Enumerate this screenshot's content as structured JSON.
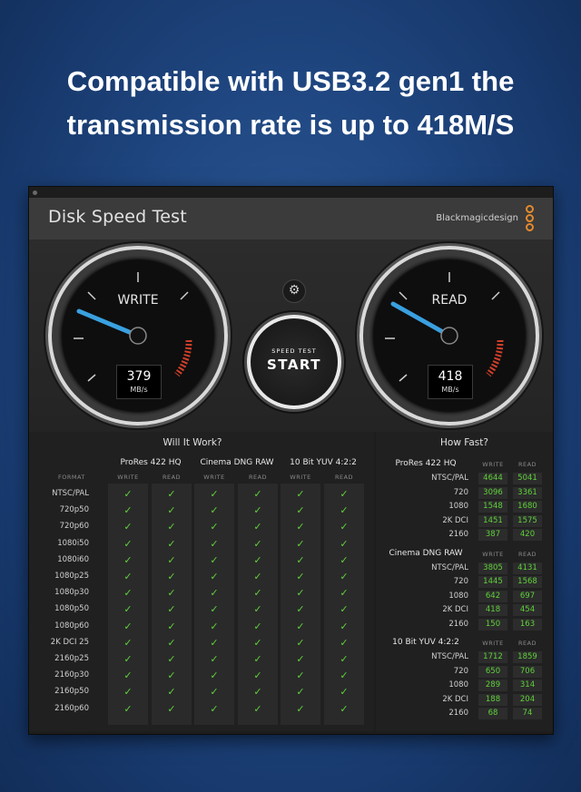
{
  "headline": {
    "line1": "Compatible with USB3.2 gen1 the",
    "line2": "transmission rate is up to 418M/S"
  },
  "app": {
    "title": "Disk Speed Test",
    "brand": "Blackmagicdesign"
  },
  "gauges": {
    "write": {
      "label": "WRITE",
      "value": "379",
      "unit": "MB/s"
    },
    "read": {
      "label": "READ",
      "value": "418",
      "unit": "MB/s"
    }
  },
  "start_button": {
    "small": "SPEED TEST",
    "big": "START"
  },
  "settings_icon": "gear-icon",
  "will_it_work": {
    "title": "Will It Work?",
    "format_header": "FORMAT",
    "write_header": "WRITE",
    "read_header": "READ",
    "codecs": [
      "ProRes 422 HQ",
      "Cinema DNG RAW",
      "10 Bit YUV 4:2:2"
    ],
    "formats": [
      "NTSC/PAL",
      "720p50",
      "720p60",
      "1080i50",
      "1080i60",
      "1080p25",
      "1080p30",
      "1080p50",
      "1080p60",
      "2K DCI 25",
      "2160p25",
      "2160p30",
      "2160p50",
      "2160p60"
    ],
    "check_symbol": "✓",
    "check_color": "#5fd23a"
  },
  "how_fast": {
    "title": "How Fast?",
    "write_header": "WRITE",
    "read_header": "READ",
    "groups": [
      {
        "name": "ProRes 422 HQ",
        "rows": [
          {
            "label": "NTSC/PAL",
            "write": "4644",
            "read": "5041"
          },
          {
            "label": "720",
            "write": "3096",
            "read": "3361"
          },
          {
            "label": "1080",
            "write": "1548",
            "read": "1680"
          },
          {
            "label": "2K DCI",
            "write": "1451",
            "read": "1575"
          },
          {
            "label": "2160",
            "write": "387",
            "read": "420"
          }
        ]
      },
      {
        "name": "Cinema DNG RAW",
        "rows": [
          {
            "label": "NTSC/PAL",
            "write": "3805",
            "read": "4131"
          },
          {
            "label": "720",
            "write": "1445",
            "read": "1568"
          },
          {
            "label": "1080",
            "write": "642",
            "read": "697"
          },
          {
            "label": "2K DCI",
            "write": "418",
            "read": "454"
          },
          {
            "label": "2160",
            "write": "150",
            "read": "163"
          }
        ]
      },
      {
        "name": "10 Bit YUV 4:2:2",
        "rows": [
          {
            "label": "NTSC/PAL",
            "write": "1712",
            "read": "1859"
          },
          {
            "label": "720",
            "write": "650",
            "read": "706"
          },
          {
            "label": "1080",
            "write": "289",
            "read": "314"
          },
          {
            "label": "2K DCI",
            "write": "188",
            "read": "204"
          },
          {
            "label": "2160",
            "write": "68",
            "read": "74"
          }
        ]
      }
    ]
  },
  "colors": {
    "accent_green": "#5fd23a",
    "needle_blue": "#3aa0e0",
    "redline": "#d0402a",
    "logo_orange": "#e28a2c"
  }
}
